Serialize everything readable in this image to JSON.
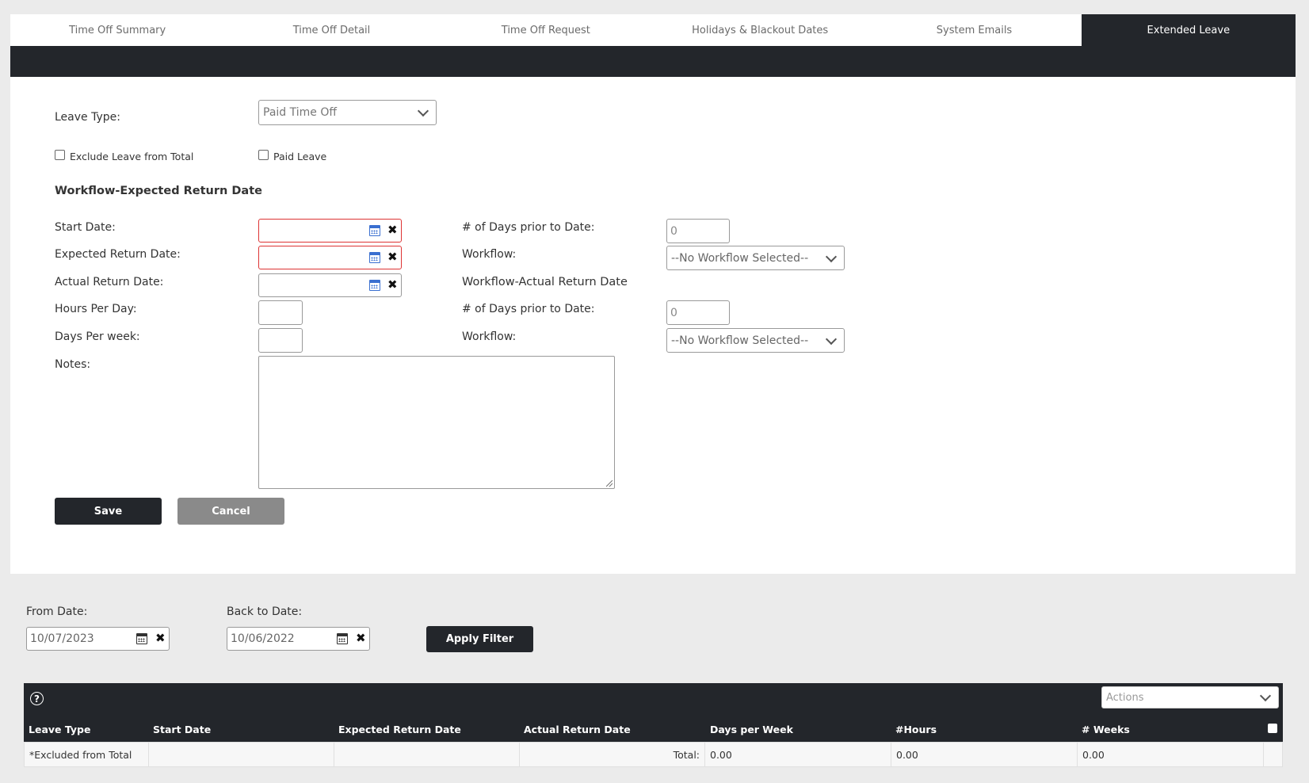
{
  "tabs": [
    {
      "label": "Time Off Summary"
    },
    {
      "label": "Time Off Detail"
    },
    {
      "label": "Time Off Request"
    },
    {
      "label": "Holidays & Blackout Dates"
    },
    {
      "label": "System Emails"
    },
    {
      "label": "Extended Leave"
    }
  ],
  "form": {
    "leave_type_label": "Leave Type:",
    "leave_type_value": "Paid Time Off",
    "exclude_label": "Exclude Leave from Total",
    "paid_leave_label": "Paid Leave",
    "section_expected": "Workflow-Expected Return Date",
    "start_date_label": "Start Date:",
    "expected_return_label": "Expected Return Date:",
    "actual_return_label": "Actual Return Date:",
    "hours_per_day_label": "Hours Per Day:",
    "days_per_week_label": "Days Per week:",
    "notes_label": "Notes:",
    "days_prior_label_1": "# of Days prior to Date:",
    "days_prior_value_1": "0",
    "workflow_label_1": "Workflow:",
    "workflow_value_1": "--No Workflow Selected--",
    "section_actual": "Workflow-Actual Return Date",
    "days_prior_label_2": "# of Days prior to Date:",
    "days_prior_value_2": "0",
    "workflow_label_2": "Workflow:",
    "workflow_value_2": "--No Workflow Selected--",
    "save_label": "Save",
    "cancel_label": "Cancel"
  },
  "filter": {
    "from_label": "From Date:",
    "from_value": "10/07/2023",
    "back_label": "Back to Date:",
    "back_value": "10/06/2022",
    "apply_label": "Apply Filter"
  },
  "grid": {
    "help_glyph": "?",
    "actions_placeholder": "Actions",
    "columns": [
      "Leave Type",
      "Start Date",
      "Expected Return Date",
      "Actual Return Date",
      "Days per Week",
      "#Hours",
      "# Weeks"
    ],
    "total_row": {
      "leave_type": "*Excluded from Total",
      "total_label": "Total:",
      "days_per_week": "0.00",
      "hours": "0.00",
      "weeks": "0.00"
    }
  },
  "icons": {
    "calendar": "calendar-icon",
    "clear": "close-icon",
    "dropdown": "chevron-down-icon",
    "help": "help-icon"
  },
  "colors": {
    "dark": "#23262b",
    "error_border": "#dd3333",
    "calendar_blue": "#3a6fd0",
    "cancel_grey": "#8a8a8a"
  }
}
